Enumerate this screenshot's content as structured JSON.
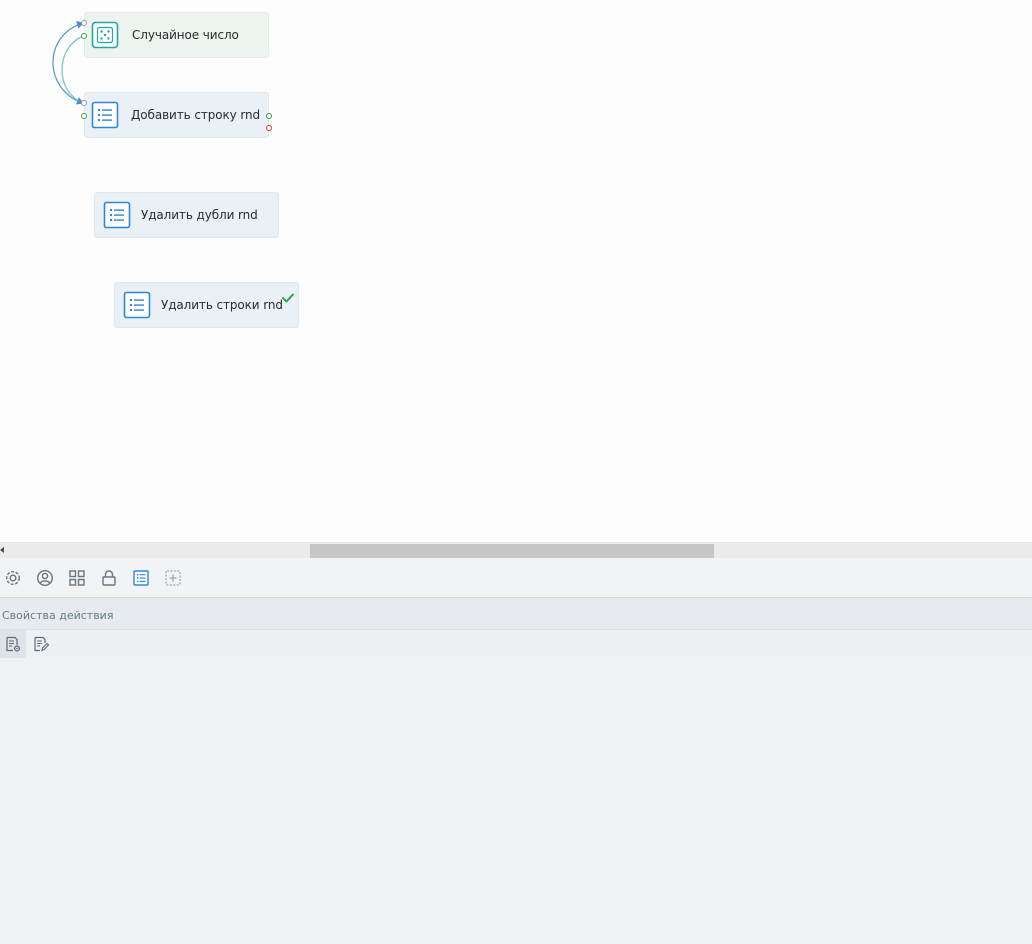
{
  "canvas": {
    "nodes": [
      {
        "label": "Случайное число",
        "icon": "dice-icon",
        "state": "source"
      },
      {
        "label": "Добавить строку rnd",
        "icon": "list-icon",
        "state": "selected"
      },
      {
        "label": "Удалить дубли rnd",
        "icon": "list-icon",
        "state": "idle"
      },
      {
        "label": "Удалить строки rnd",
        "icon": "list-icon",
        "state": "done"
      }
    ]
  },
  "toolbar": {
    "buttons": [
      "settings-icon",
      "user-circle-icon",
      "grid-icon",
      "lock-icon",
      "list-doc-icon",
      "add-block-icon"
    ]
  },
  "properties": {
    "title": "Свойства действия",
    "tabs": [
      "doc-settings-icon",
      "doc-edit-icon"
    ]
  },
  "colors": {
    "accent": "#2f86d6",
    "teal": "#25a4a8",
    "success": "#2ea44f",
    "error": "#d63a3a"
  }
}
